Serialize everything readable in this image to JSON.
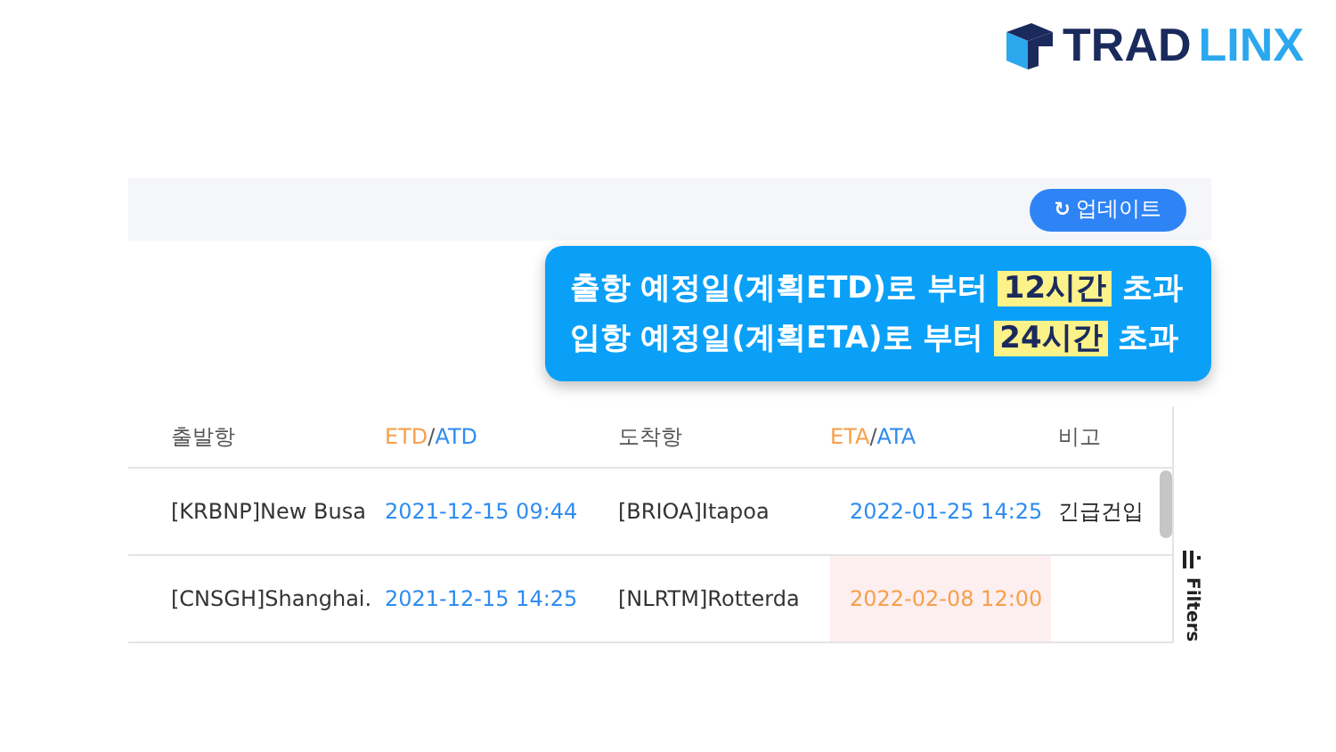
{
  "logo": {
    "part_1": "TRAD",
    "part_2": "LINX"
  },
  "toolbar": {
    "update_button": {
      "icon": "↻",
      "label": "업데이트"
    }
  },
  "tooltip": {
    "lines": [
      {
        "before": "출항 예정일(계획ETD)로 부터",
        "highlight": "12시간",
        "after": "초과"
      },
      {
        "before": "입항 예정일(계획ETA)로 부터",
        "highlight": "24시간",
        "after": "초과"
      }
    ]
  },
  "table": {
    "columns": [
      {
        "parts": [
          {
            "kind": "plain",
            "text": "출발항"
          }
        ]
      },
      {
        "parts": [
          {
            "kind": "estimate",
            "text": "ETD"
          },
          {
            "kind": "plain",
            "text": "/"
          },
          {
            "kind": "actual",
            "text": "ATD"
          }
        ]
      },
      {
        "parts": [
          {
            "kind": "plain",
            "text": "도착항"
          }
        ]
      },
      {
        "parts": [
          {
            "kind": "estimate",
            "text": "ETA"
          },
          {
            "kind": "plain",
            "text": "/"
          },
          {
            "kind": "actual",
            "text": "ATA"
          }
        ]
      },
      {
        "parts": [
          {
            "kind": "plain",
            "text": "비고"
          }
        ]
      }
    ],
    "rows": [
      {
        "origin": "[KRBNP]New Busa",
        "etd": "2021-12-15 09:44",
        "destination": "[BRIOA]Itapoa",
        "eta": "2022-01-25 14:25",
        "eta_delayed": false,
        "note": "긴급건입"
      },
      {
        "origin": "[CNSGH]Shanghai.",
        "etd": "2021-12-15 14:25",
        "destination": "[NLRTM]Rotterda",
        "eta": "2022-02-08 12:00",
        "eta_delayed": true
      }
    ]
  },
  "filters_tab": {
    "label": "Filters"
  }
}
